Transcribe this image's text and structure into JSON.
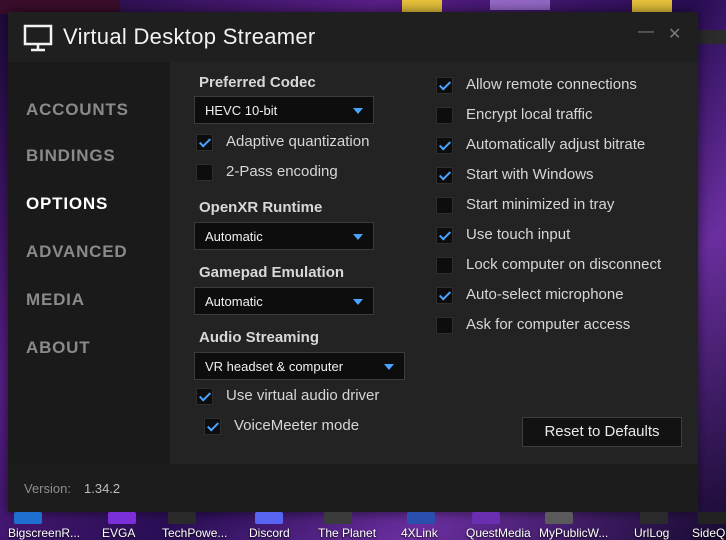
{
  "window": {
    "title": "Virtual Desktop Streamer",
    "minimize_glyph": "—",
    "close_glyph": "✕"
  },
  "sidebar": {
    "items": [
      {
        "label": "ACCOUNTS"
      },
      {
        "label": "BINDINGS"
      },
      {
        "label": "OPTIONS",
        "active": true
      },
      {
        "label": "ADVANCED"
      },
      {
        "label": "MEDIA"
      },
      {
        "label": "ABOUT"
      }
    ]
  },
  "options": {
    "preferred_codec": {
      "label": "Preferred Codec",
      "value": "HEVC 10-bit"
    },
    "adaptive_quantization": {
      "label": "Adaptive quantization",
      "checked": true
    },
    "two_pass": {
      "label": "2-Pass encoding",
      "checked": false
    },
    "openxr": {
      "label": "OpenXR Runtime",
      "value": "Automatic"
    },
    "gamepad": {
      "label": "Gamepad Emulation",
      "value": "Automatic"
    },
    "audio": {
      "label": "Audio Streaming",
      "value": "VR headset & computer"
    },
    "virtual_audio": {
      "label": "Use virtual audio driver",
      "checked": true
    },
    "voicemeeter": {
      "label": "VoiceMeeter mode",
      "checked": true
    },
    "right_checks": [
      {
        "label": "Allow remote connections",
        "checked": true
      },
      {
        "label": "Encrypt local traffic",
        "checked": false
      },
      {
        "label": "Automatically adjust bitrate",
        "checked": true
      },
      {
        "label": "Start with Windows",
        "checked": true
      },
      {
        "label": "Start minimized in tray",
        "checked": false
      },
      {
        "label": "Use touch input",
        "checked": true
      },
      {
        "label": "Lock computer on disconnect",
        "checked": false
      },
      {
        "label": "Auto-select microphone",
        "checked": true
      },
      {
        "label": "Ask for computer access",
        "checked": false
      }
    ],
    "reset_label": "Reset to Defaults"
  },
  "footer": {
    "version_label": "Version:",
    "version_value": "1.34.2"
  },
  "desktop": {
    "icons": [
      {
        "label": "BigscreenR...",
        "color": "#1f6fd1"
      },
      {
        "label": "EVGA",
        "color": "#7b2fd6"
      },
      {
        "label": "TechPowe...",
        "color": "#2a2a2a"
      },
      {
        "label": "Discord",
        "color": "#5865f2"
      },
      {
        "label": "The Planet",
        "color": "#3b3b3b"
      },
      {
        "label": "4XLink",
        "color": "#2b4fae"
      },
      {
        "label": "QuestMedia",
        "color": "#6a2fb0"
      },
      {
        "label": "MyPublicW...",
        "color": "#5a5a5a"
      },
      {
        "label": "UrlLog",
        "color": "#2b2b2b"
      },
      {
        "label": "SideQ",
        "color": "#222222"
      }
    ]
  },
  "colors": {
    "accent": "#4aa3ff",
    "window_bg": "#1f1f1f"
  }
}
